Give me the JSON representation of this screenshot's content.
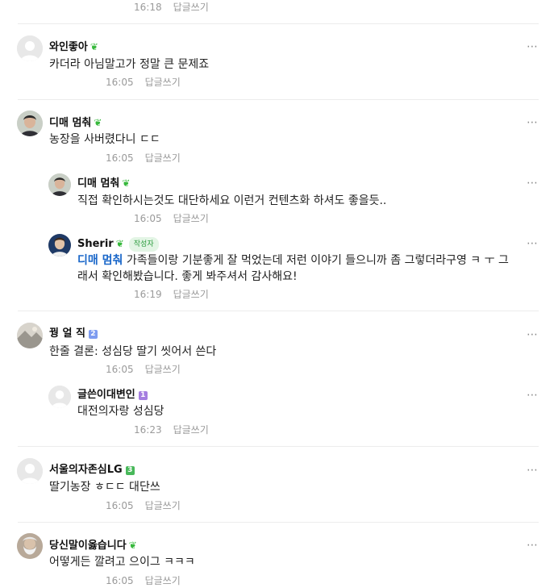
{
  "reply_label": "답글쓰기",
  "top_fragment": {
    "time": "16:18",
    "reply": "답글쓰기"
  },
  "comments": [
    {
      "author": "와인좋아",
      "leaf": "❦",
      "text": "카더라 아님말고가 정말 큰 문제죠",
      "time": "16:05",
      "reply": "답글쓰기"
    },
    {
      "author": "디매 멈춰",
      "leaf": "❦",
      "text": "농장을 사버렸다니 ㄷㄷ",
      "time": "16:05",
      "reply": "답글쓰기",
      "replies": [
        {
          "author": "디매 멈춰",
          "leaf": "❦",
          "text": "직접 확인하시는것도 대단하세요 이런거 컨텐츠화 하셔도 좋을듯..",
          "time": "16:05",
          "reply": "답글쓰기"
        },
        {
          "author": "Sherir",
          "leaf": "❦",
          "author_badge": "작성자",
          "mention": "디매 멈춰",
          "text_line1": " 가족들이랑 기분좋게 잘 먹었는데 저런 이야기 들으니까 좀 그렇더라구영 ㅋ ㅜ 그",
          "text_line2": "래서 확인해봤습니다. 좋게 봐주셔서 감사해요!",
          "time": "16:19",
          "reply": "답글쓰기"
        }
      ]
    },
    {
      "author": "꿩 얼 직",
      "level": "2",
      "text": "한줄 결론: 성심당 딸기 씻어서 쓴다",
      "time": "16:05",
      "reply": "답글쓰기",
      "replies": [
        {
          "author": "글쓴이대변인",
          "level": "1",
          "text": "대전의자랑 성심당",
          "time": "16:23",
          "reply": "답글쓰기"
        }
      ]
    },
    {
      "author": "서울의자존심LG",
      "level": "3",
      "text": "딸기농장 ㅎㄷㄷ 대단쓰",
      "time": "16:05",
      "reply": "답글쓰기"
    },
    {
      "author": "당신말이옳습니다",
      "leaf": "❦",
      "text": "어떻게든 깔려고 으이그 ㅋㅋㅋ",
      "time": "16:05",
      "reply": "답글쓰기"
    }
  ],
  "more_icon": "⋯",
  "colors": {
    "leaf": "#36b83b",
    "mention": "#1a67c9",
    "level_blue": "#7e9cf0",
    "level_purple": "#a57ee0",
    "level_green": "#48b85a",
    "meta": "#9a9a9a"
  }
}
